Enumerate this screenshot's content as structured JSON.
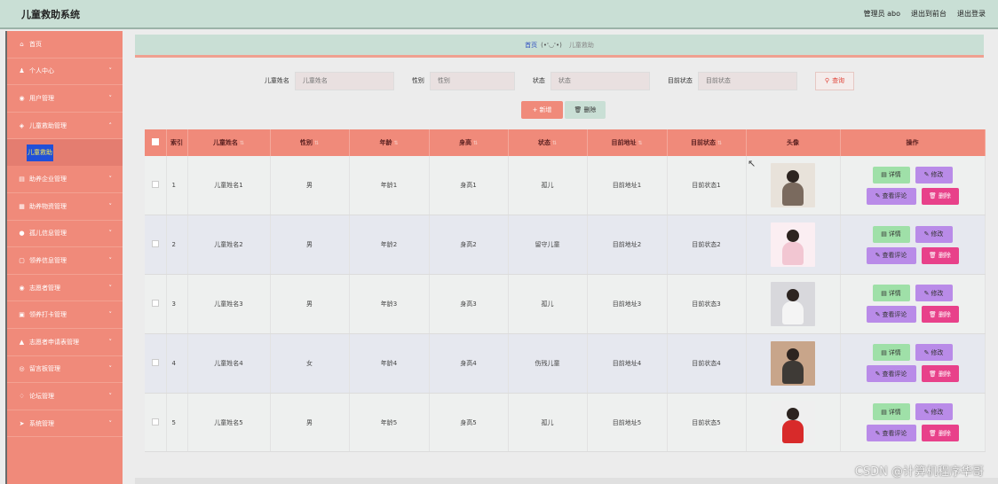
{
  "app": {
    "title": "儿童救助系统"
  },
  "topbar": {
    "admin": "管理员 abo",
    "back_front": "退出到前台",
    "logout": "退出登录"
  },
  "sidebar": {
    "items": [
      {
        "icon": "home-icon",
        "label": "首页",
        "has_children": false
      },
      {
        "icon": "user-icon",
        "label": "个人中心",
        "has_children": true
      },
      {
        "icon": "users-icon",
        "label": "用户管理",
        "has_children": true
      },
      {
        "icon": "shield-icon",
        "label": "儿童救助管理",
        "has_children": true,
        "expanded": true,
        "children": [
          "儿童救助"
        ]
      },
      {
        "icon": "id-card-icon",
        "label": "助养企业管理",
        "has_children": true
      },
      {
        "icon": "grid-icon",
        "label": "助养物资管理",
        "has_children": true
      },
      {
        "icon": "pin-icon",
        "label": "孤儿信息管理",
        "has_children": true
      },
      {
        "icon": "message-icon",
        "label": "领养信息管理",
        "has_children": true
      },
      {
        "icon": "circle-icon",
        "label": "志愿者管理",
        "has_children": true
      },
      {
        "icon": "checkin-icon",
        "label": "领养打卡管理",
        "has_children": true
      },
      {
        "icon": "bank-icon",
        "label": "志愿者申请表管理",
        "has_children": true
      },
      {
        "icon": "board-icon",
        "label": "留言板管理",
        "has_children": true
      },
      {
        "icon": "forum-icon",
        "label": "论坛管理",
        "has_children": true
      },
      {
        "icon": "send-icon",
        "label": "系统管理",
        "has_children": true
      }
    ]
  },
  "breadcrumb": {
    "home": "首页",
    "emoticon": "(•'◡'•)",
    "current": "儿童救助"
  },
  "search": {
    "name_label": "儿童姓名",
    "name_placeholder": "儿童姓名",
    "gender_label": "性别",
    "gender_placeholder": "性别",
    "status_label": "状态",
    "status_placeholder": "状态",
    "current_status_label": "目前状态",
    "current_status_placeholder": "目前状态",
    "query_button": "查询"
  },
  "actions": {
    "add": "新增",
    "delete": "删除"
  },
  "table": {
    "headers": {
      "index": "索引",
      "name": "儿童姓名",
      "gender": "性别",
      "age": "年龄",
      "height": "身高",
      "status": "状态",
      "address": "目前地址",
      "current_status": "目前状态",
      "avatar": "头像",
      "ops": "操作"
    },
    "op_labels": {
      "detail": "详情",
      "edit": "修改",
      "review": "查看评论",
      "delete": "删除"
    },
    "rows": [
      {
        "index": "1",
        "name": "儿童姓名1",
        "gender": "男",
        "age": "年龄1",
        "height": "身高1",
        "status": "孤儿",
        "address": "目前地址1",
        "current_status": "目前状态1",
        "avatar_colors": [
          "#7a6a5e",
          "#e8e2da"
        ]
      },
      {
        "index": "2",
        "name": "儿童姓名2",
        "gender": "男",
        "age": "年龄2",
        "height": "身高2",
        "status": "留守儿童",
        "address": "目前地址2",
        "current_status": "目前状态2",
        "avatar_colors": [
          "#f2c6d2",
          "#fbeef2"
        ]
      },
      {
        "index": "3",
        "name": "儿童姓名3",
        "gender": "男",
        "age": "年龄3",
        "height": "身高3",
        "status": "孤儿",
        "address": "目前地址3",
        "current_status": "目前状态3",
        "avatar_colors": [
          "#f4f4f4",
          "#d8d8dc"
        ]
      },
      {
        "index": "4",
        "name": "儿童姓名4",
        "gender": "女",
        "age": "年龄4",
        "height": "身高4",
        "status": "伤残儿童",
        "address": "目前地址4",
        "current_status": "目前状态4",
        "avatar_colors": [
          "#3e3a36",
          "#c8a58a"
        ]
      },
      {
        "index": "5",
        "name": "儿童姓名5",
        "gender": "男",
        "age": "年龄5",
        "height": "身高5",
        "status": "孤儿",
        "address": "目前地址5",
        "current_status": "目前状态5",
        "avatar_colors": [
          "#d82a2a",
          "#efefef"
        ]
      }
    ]
  },
  "watermark": "CSDN @计算机程序华哥"
}
